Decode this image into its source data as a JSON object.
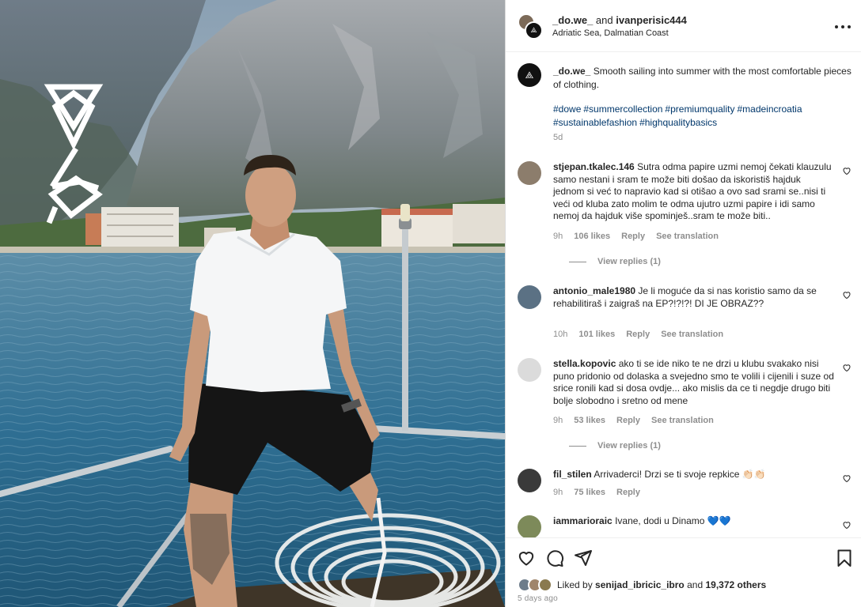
{
  "post": {
    "author_primary": "_do.we_",
    "connector": "and",
    "author_secondary": "ivanperisic444",
    "location": "Adriatic Sea, Dalmatian Coast",
    "more_icon": "more-horizontal-icon"
  },
  "caption": {
    "username": "_do.we_",
    "text": "Smooth sailing into summer with the most comfortable pieces of clothing.",
    "hashtags": [
      "#dowe",
      "#summercollection",
      "#premiumquality",
      "#madeincroatia",
      "#sustainablefashion",
      "#highqualitybasics"
    ],
    "time": "5d"
  },
  "comments": [
    {
      "username": "stjepan.tkalec.146",
      "text": "Sutra odma papire uzmi nemoj čekati klauzulu samo nestani i sram te može biti došao da iskoristiš hajduk jednom si već to napravio kad si otišao a ovo sad srami se..nisi ti veći od kluba zato molim te odma ujutro uzmi papire i idi samo nemoj da hajduk više spominješ..sram te može biti..",
      "time": "9h",
      "likes": "106 likes",
      "reply": "Reply",
      "translate": "See translation",
      "view_replies": "View replies (1)"
    },
    {
      "username": "antonio_male1980",
      "text": "Je li moguće da si nas koristio samo da se rehabilitiraš i zaigraš na EP?!?!?! DI JE OBRAZ??",
      "time": "10h",
      "likes": "101 likes",
      "reply": "Reply",
      "translate": "See translation"
    },
    {
      "username": "stella.kopovic",
      "text": "ako ti se ide niko te ne drzi u klubu svakako nisi puno pridonio od dolaska a svejedno smo te volili i cijenili i suze od srice ronili kad si dosa ovdje... ako mislis da ce ti negdje drugo biti bolje slobodno i sretno od mene",
      "time": "9h",
      "likes": "53 likes",
      "reply": "Reply",
      "translate": "See translation",
      "view_replies": "View replies (1)"
    },
    {
      "username": "fil_stilen",
      "text": "Arrivaderci! Drzi se ti svoje repkice 👏🏻👏🏻",
      "time": "9h",
      "likes": "75 likes",
      "reply": "Reply"
    },
    {
      "username": "iammarioraic",
      "text": "Ivane, dodi u Dinamo 💙💙"
    }
  ],
  "actions": {
    "icons": [
      "heart-icon",
      "comment-icon",
      "share-icon",
      "bookmark-icon"
    ]
  },
  "likes": {
    "prefix": "Liked by",
    "user": "senijad_ibricic_ibro",
    "connector": "and",
    "others": "19,372 others"
  },
  "date": "5 days ago",
  "colors": {
    "hashtag": "#00376b",
    "muted": "#8e8e8e",
    "text": "#262626",
    "sea": "#2f6f93",
    "mountain": "#8d9398"
  }
}
